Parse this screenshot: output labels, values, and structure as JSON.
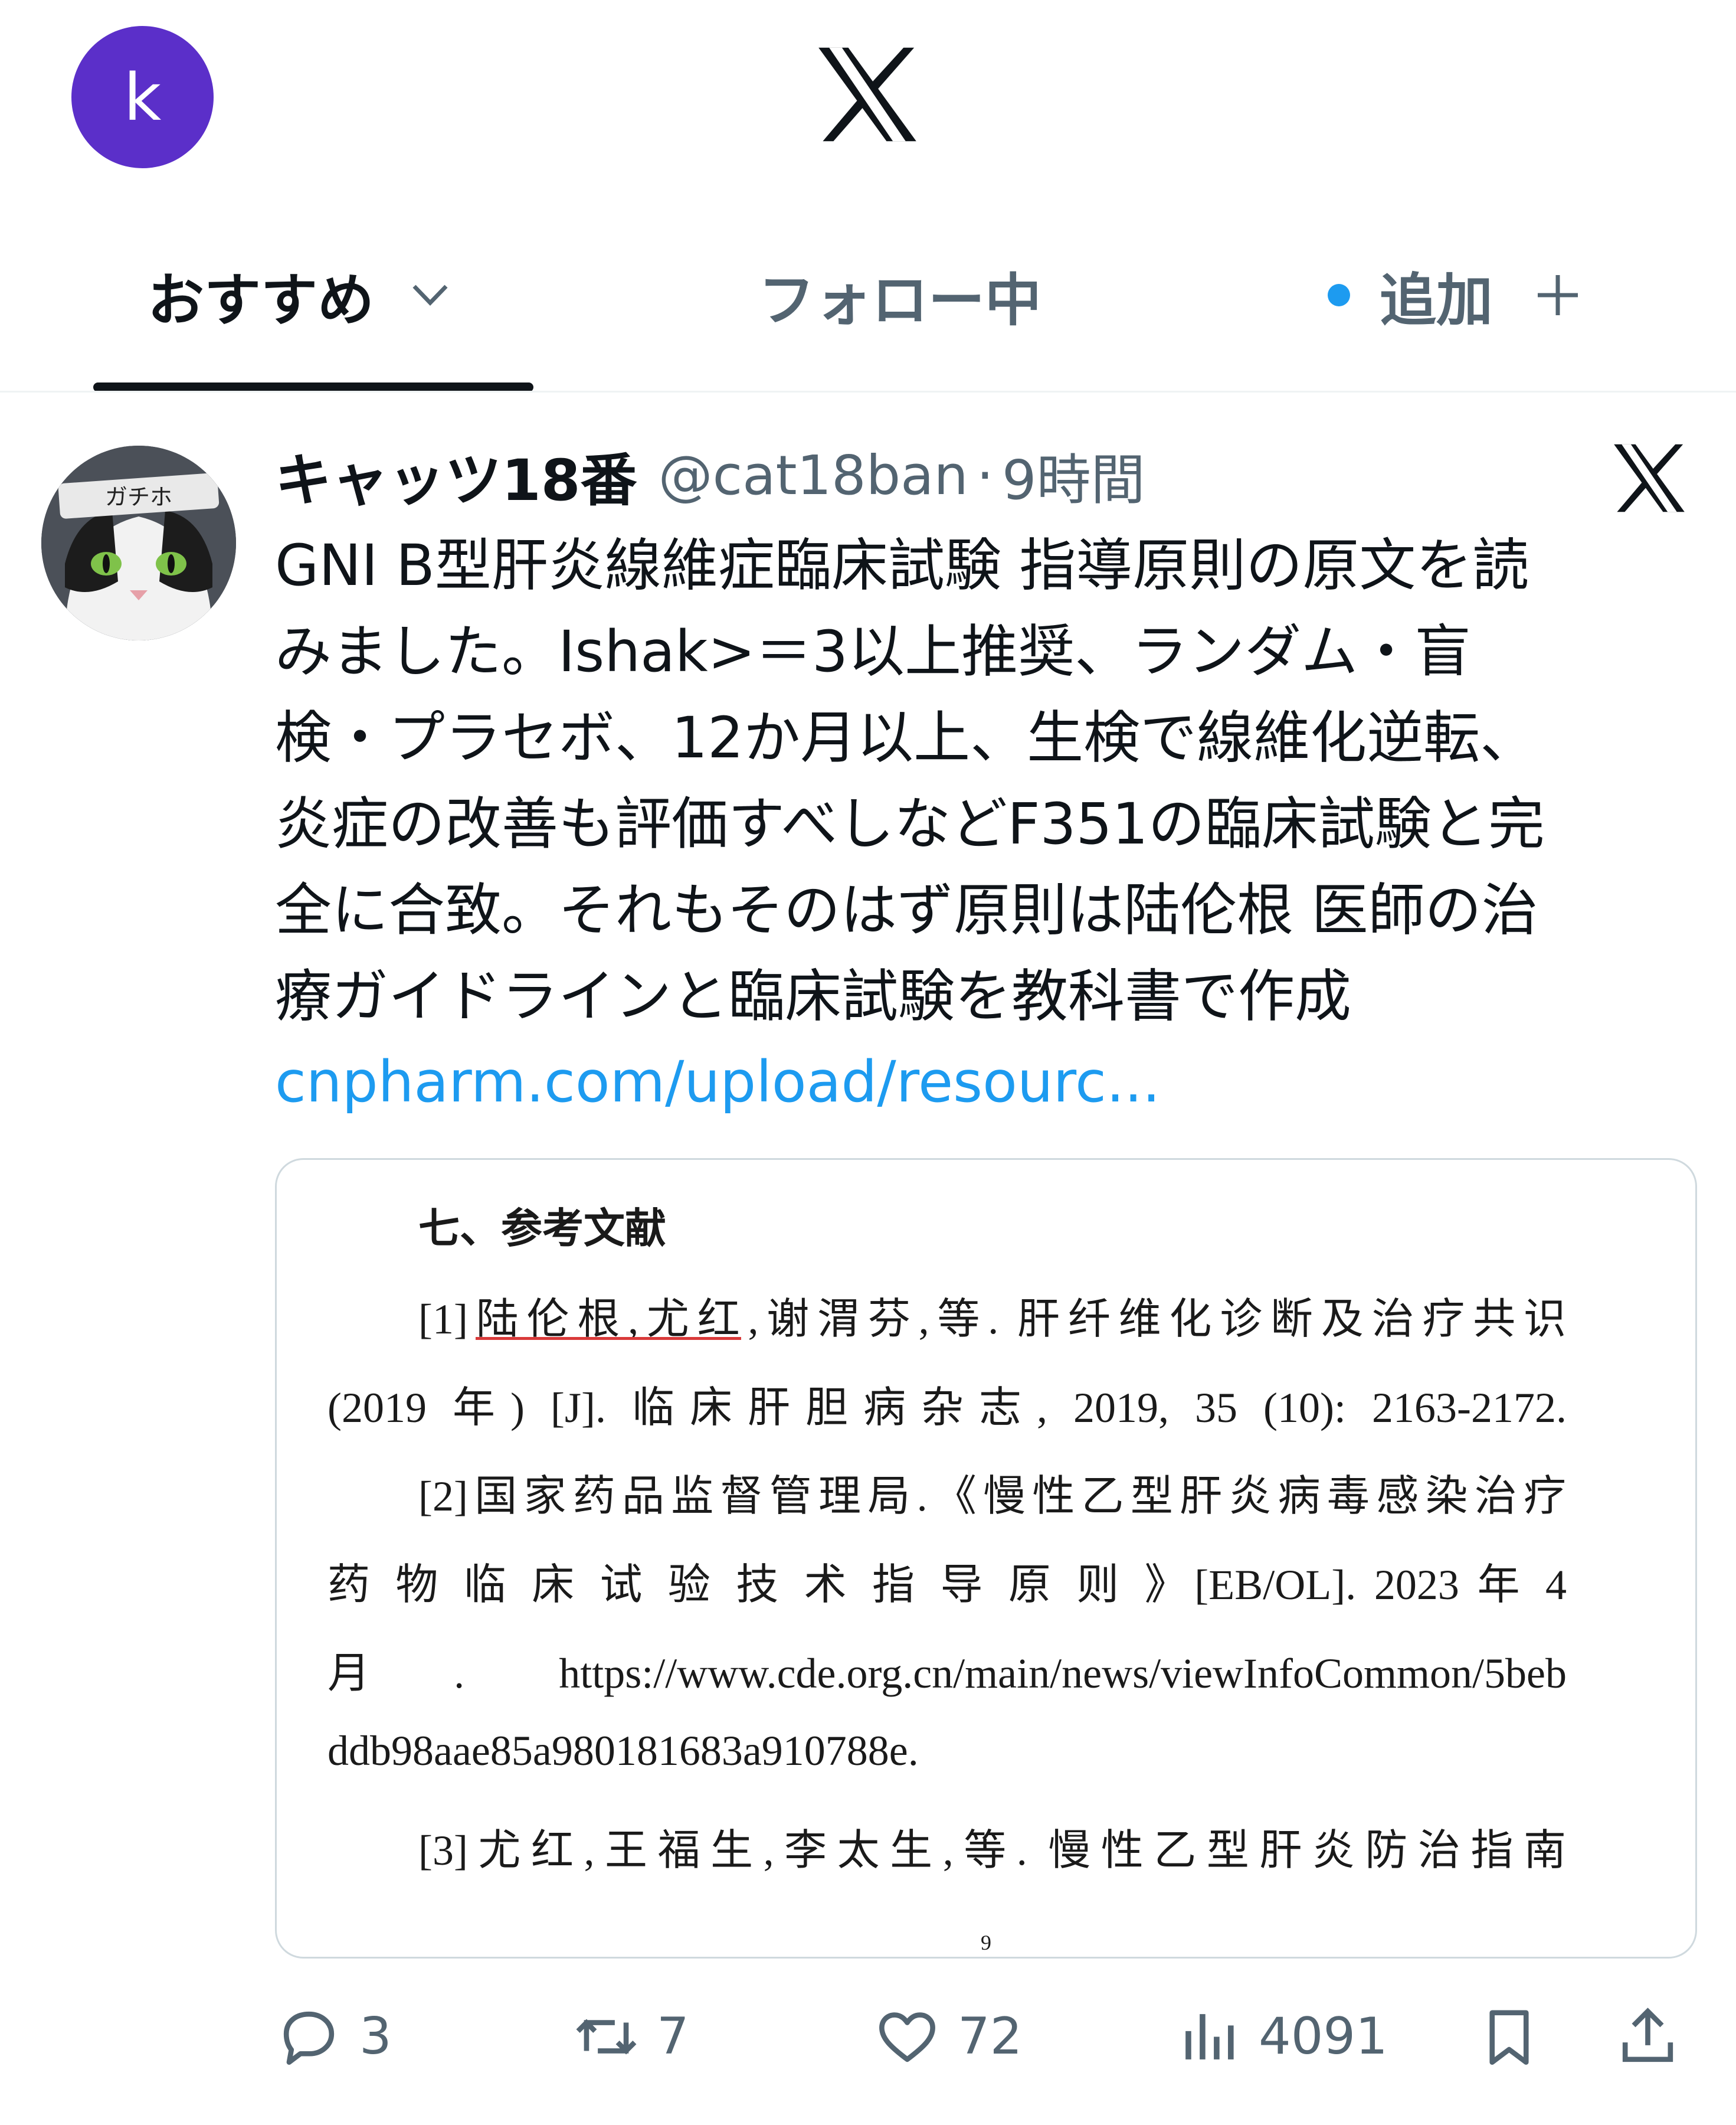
{
  "header": {
    "avatar_letter": "k"
  },
  "tabs": [
    {
      "label": "おすすめ"
    },
    {
      "label": "フォロー中"
    },
    {
      "label": "追加"
    }
  ],
  "tweet": {
    "avatar_caption": "ガチホ",
    "author_name": "キャッツ18番",
    "handle": "@cat18ban",
    "separator": "·",
    "time": "9時間",
    "text_lines": [
      "GNI B型肝炎線維症臨床試験 指導原則の原文を読",
      "みました。Ishak>＝3以上推奨、ランダム・盲",
      "検・プラセボ、12か月以上、生検で線維化逆転、",
      "炎症の改善も評価すべしなどF351の臨床試験と完",
      "全に合致。それもそのはず原則は陆伦根 医師の治",
      "療ガイドラインと臨床試験を教科書で作成"
    ],
    "link": "cnpharm.com/upload/resourc..."
  },
  "document": {
    "heading": "七、参考文献",
    "lines": [
      "[1]陆伦根,尤红,谢渭芬,等. 肝纤维化诊断及治疗共识",
      "(2019 年) [J]. 临床肝胆病杂志, 2019, 35 (10): 2163-2172.",
      "[2]国家药品监督管理局.《慢性乙型肝炎病毒感染治疗",
      "药 物 临 床 试 验 技 术 指 导 原 则 》[EB/OL]. 2023 年 4",
      "月. https://www.cde.org.cn/main/news/viewInfoCommon/5beb",
      "ddb98aae85a980181683a910788e.",
      "[3]尤红,王福生,李太生,等. 慢性乙型肝炎防治指南"
    ],
    "page_number": "9"
  },
  "actions": {
    "replies": "3",
    "retweets": "7",
    "likes": "72",
    "views": "4091"
  }
}
